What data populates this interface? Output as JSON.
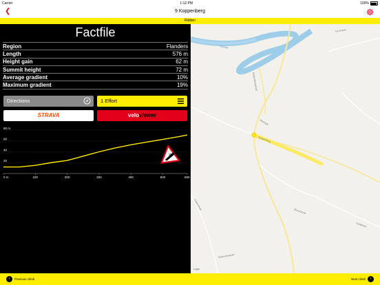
{
  "status": {
    "carrier": "Carrier",
    "time": "1:12 PM",
    "battery": "100%"
  },
  "nav": {
    "title": "9 Koppenberg"
  },
  "ribbon": {
    "label": "Ridden"
  },
  "factfile": {
    "title": "Factfile",
    "rows": [
      {
        "label": "Region",
        "value": "Flanders"
      },
      {
        "label": "Length",
        "value": "576 m"
      },
      {
        "label": "Height gain",
        "value": "62 m"
      },
      {
        "label": "Summit height",
        "value": "72 m"
      },
      {
        "label": "Average gradient",
        "value": "10%"
      },
      {
        "label": "Maximum gradient",
        "value": "19%"
      }
    ]
  },
  "buttons": {
    "directions": "Directions",
    "effort": "1 Effort",
    "strava": "STRAVA",
    "velo_part1": "velo",
    "velo_part2": "viewer"
  },
  "chart_data": {
    "type": "area",
    "x_ticks": [
      "0 m",
      "100",
      "200",
      "300",
      "400",
      "500",
      "600"
    ],
    "y_ticks": [
      "20",
      "40",
      "60",
      "80 m"
    ],
    "x": [
      0,
      50,
      100,
      150,
      200,
      250,
      300,
      350,
      400,
      450,
      500,
      550,
      576
    ],
    "y": [
      12,
      12,
      15,
      20,
      24,
      32,
      40,
      47,
      53,
      58,
      63,
      68,
      71
    ],
    "xlim": [
      0,
      576
    ],
    "ylim": [
      0,
      80
    ],
    "line_color": "#ffed00",
    "gradient_sign": "19%"
  },
  "map": {
    "labels": [
      "Schelde",
      "Koppenberg",
      "Broekstraat",
      "Steengat",
      "Ten Bosse",
      "Gaverstraat",
      "Zuidstraat",
      "Lepel",
      "Koppenbergstraat",
      "Tenbossestraat"
    ],
    "legal": "Legal"
  },
  "footer": {
    "prev": "Previous climb",
    "next": "Next climb"
  },
  "colors": {
    "accent": "#e2001a",
    "yellow": "#ffed00"
  }
}
